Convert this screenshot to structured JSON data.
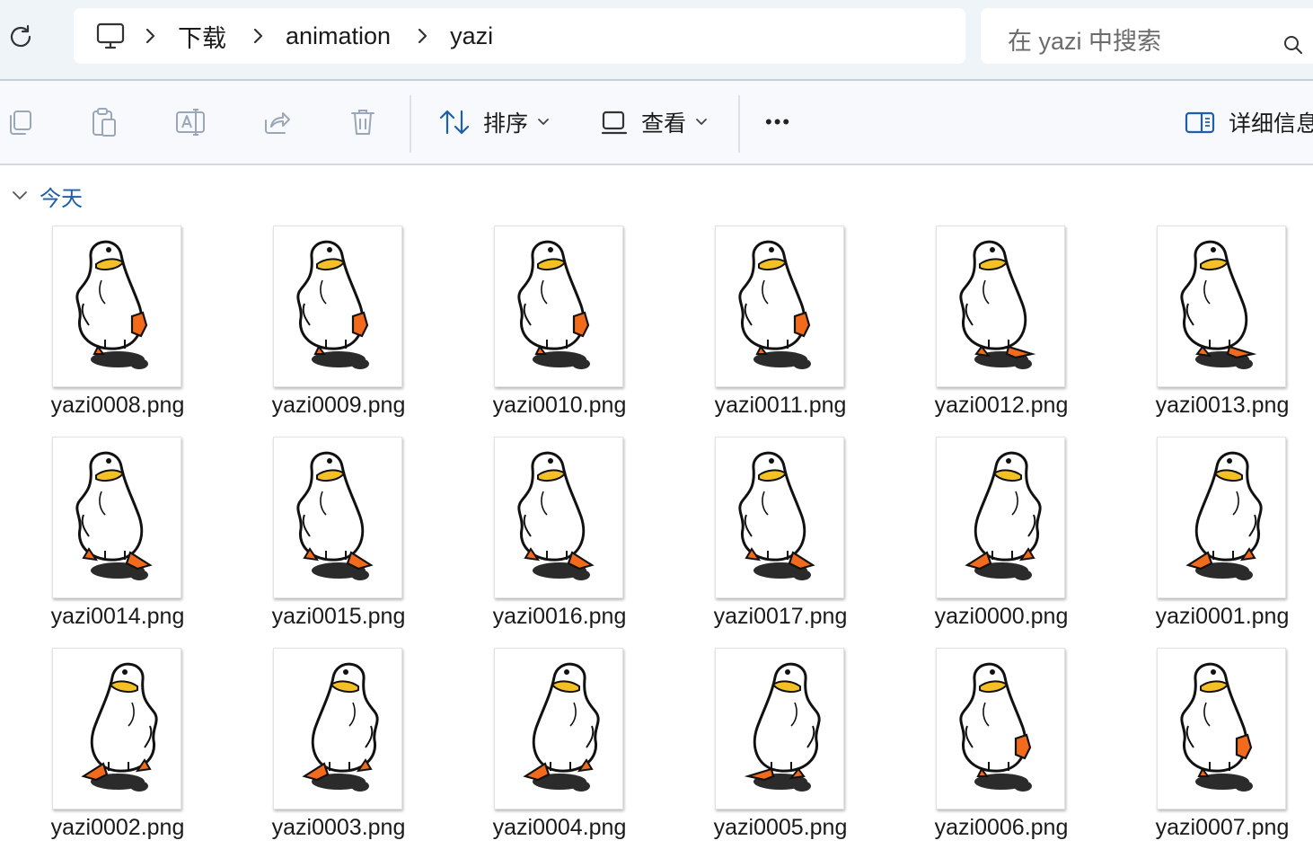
{
  "nav": {
    "refresh_icon": "refresh-icon"
  },
  "breadcrumb": {
    "pc_icon": "computer-icon",
    "items": [
      "下载",
      "animation",
      "yazi"
    ]
  },
  "search": {
    "placeholder": "在 yazi 中搜索",
    "icon": "search-icon"
  },
  "toolbar": {
    "icons": [
      "copy-icon",
      "paste-icon",
      "rename-icon",
      "share-icon",
      "delete-icon"
    ],
    "sort_label": "排序",
    "view_label": "查看",
    "more_label": "•••",
    "details_label": "详细信息"
  },
  "group": {
    "label": "今天"
  },
  "files": [
    {
      "name": "yazi0008.png",
      "pose": "front",
      "foot": "raised"
    },
    {
      "name": "yazi0009.png",
      "pose": "front",
      "foot": "raised"
    },
    {
      "name": "yazi0010.png",
      "pose": "front",
      "foot": "raised"
    },
    {
      "name": "yazi0011.png",
      "pose": "front",
      "foot": "raised"
    },
    {
      "name": "yazi0012.png",
      "pose": "front",
      "foot": "flat"
    },
    {
      "name": "yazi0013.png",
      "pose": "front",
      "foot": "flat"
    },
    {
      "name": "yazi0014.png",
      "pose": "back",
      "foot": "forward"
    },
    {
      "name": "yazi0015.png",
      "pose": "back",
      "foot": "forward"
    },
    {
      "name": "yazi0016.png",
      "pose": "back",
      "foot": "forward"
    },
    {
      "name": "yazi0017.png",
      "pose": "back",
      "foot": "forward"
    },
    {
      "name": "yazi0000.png",
      "pose": "right",
      "foot": "lifted"
    },
    {
      "name": "yazi0001.png",
      "pose": "right",
      "foot": "lifted"
    },
    {
      "name": "yazi0002.png",
      "pose": "right",
      "foot": "lifted"
    },
    {
      "name": "yazi0003.png",
      "pose": "right",
      "foot": "lifted"
    },
    {
      "name": "yazi0004.png",
      "pose": "right",
      "foot": "lifted"
    },
    {
      "name": "yazi0005.png",
      "pose": "right",
      "foot": "flat"
    },
    {
      "name": "yazi0006.png",
      "pose": "front",
      "foot": "raised"
    },
    {
      "name": "yazi0007.png",
      "pose": "front",
      "foot": "raised"
    }
  ]
}
